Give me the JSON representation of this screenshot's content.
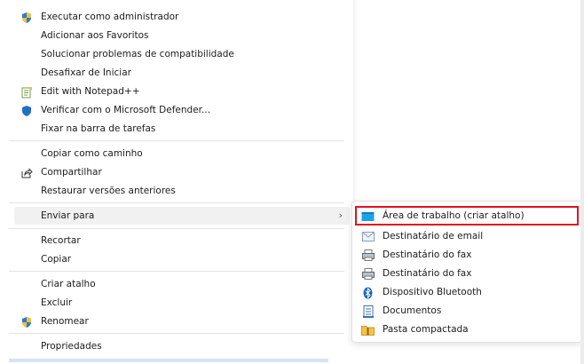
{
  "context_menu": {
    "items": [
      {
        "label": "Executar como administrador",
        "icon": "shield-icon"
      },
      {
        "label": "Adicionar aos Favoritos",
        "icon": ""
      },
      {
        "label": "Solucionar problemas de compatibilidade",
        "icon": ""
      },
      {
        "label": "Desafixar de Iniciar",
        "icon": ""
      },
      {
        "label": "Edit with Notepad++",
        "icon": "notepad-icon"
      },
      {
        "label": "Verificar com o Microsoft Defender...",
        "icon": "defender-icon"
      },
      {
        "label": "Fixar na barra de tarefas",
        "icon": ""
      },
      {
        "label": "Copiar como caminho",
        "icon": ""
      },
      {
        "label": "Compartilhar",
        "icon": "share-icon"
      },
      {
        "label": "Restaurar versões anteriores",
        "icon": ""
      },
      {
        "label": "Enviar para",
        "icon": "",
        "submenu_arrow": "›"
      },
      {
        "label": "Recortar",
        "icon": ""
      },
      {
        "label": "Copiar",
        "icon": ""
      },
      {
        "label": "Criar atalho",
        "icon": ""
      },
      {
        "label": "Excluir",
        "icon": ""
      },
      {
        "label": "Renomear",
        "icon": "shield-icon"
      },
      {
        "label": "Propriedades",
        "icon": ""
      }
    ]
  },
  "send_to_submenu": {
    "items": [
      {
        "label": "Área de trabalho (criar atalho)",
        "icon": "desktop-icon"
      },
      {
        "label": "Destinatário de email",
        "icon": "mail-icon"
      },
      {
        "label": "Destinatário do fax",
        "icon": "fax-icon"
      },
      {
        "label": "Destinatário do fax",
        "icon": "fax-icon"
      },
      {
        "label": "Dispositivo Bluetooth",
        "icon": "bluetooth-icon"
      },
      {
        "label": "Documentos",
        "icon": "documents-icon"
      },
      {
        "label": "Pasta compactada",
        "icon": "zip-folder-icon"
      }
    ]
  },
  "colors": {
    "highlight_border": "#e0141e",
    "hover_bg": "#f1f1f1",
    "separator": "#e3e3e3"
  }
}
